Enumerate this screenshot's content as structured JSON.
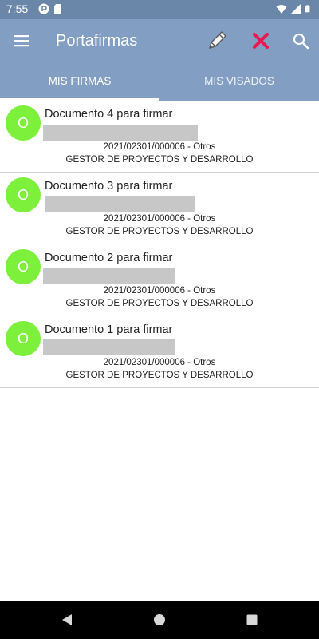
{
  "status": {
    "time": "7:55"
  },
  "app": {
    "title": "Portafirmas",
    "accent": "#839ec3"
  },
  "tabs": [
    {
      "label": "MIS FIRMAS",
      "selected": true
    },
    {
      "label": "MIS VISADOS",
      "selected": false
    }
  ],
  "documents": [
    {
      "avatar": "O",
      "title": "Documento 4 para firmar",
      "reference": "2021/02301/000006  -  Otros",
      "department": "GESTOR DE PROYECTOS Y DESARROLLO"
    },
    {
      "avatar": "O",
      "title": "Documento 3 para firmar",
      "reference": "2021/02301/000006  -  Otros",
      "department": "GESTOR DE PROYECTOS Y DESARROLLO"
    },
    {
      "avatar": "O",
      "title": "Documento 2 para firmar",
      "reference": "2021/02301/000006  -  Otros",
      "department": "GESTOR DE PROYECTOS Y DESARROLLO"
    },
    {
      "avatar": "O",
      "title": "Documento 1 para firmar",
      "reference": "2021/02301/000006  -  Otros",
      "department": "GESTOR DE PROYECTOS Y DESARROLLO"
    }
  ],
  "icons": {
    "menu": "hamburger-menu-icon",
    "sign": "pencil-icon",
    "reject": "close-x-icon",
    "search": "search-icon"
  }
}
